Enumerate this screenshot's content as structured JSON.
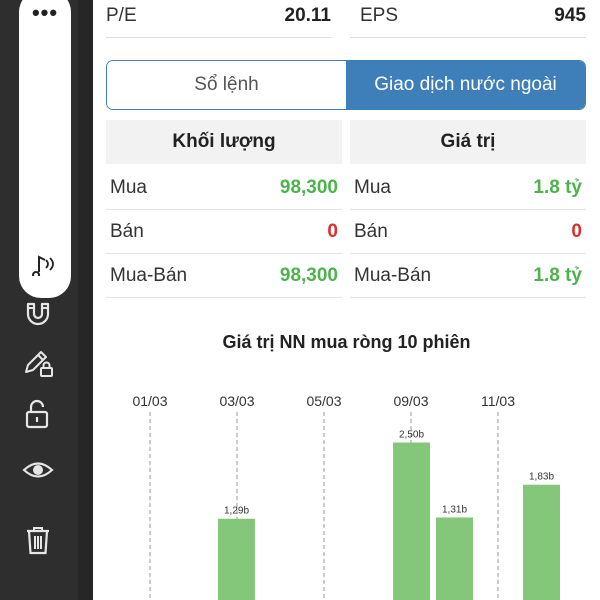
{
  "toolbar": {
    "menu_dots": "•••",
    "icons": [
      "music-notes-icon",
      "magnet-icon",
      "pencil-lock-icon",
      "unlock-icon",
      "eye-icon",
      "trash-icon"
    ]
  },
  "stats": {
    "pe_label": "P/E",
    "pe_value": "20.11",
    "eps_label": "EPS",
    "eps_value": "945"
  },
  "tabs": [
    {
      "label": "Sổ lệnh",
      "active": false
    },
    {
      "label": "Giao dịch nước ngoài",
      "active": true
    }
  ],
  "volume": {
    "header": "Khối lượng",
    "rows": [
      {
        "label": "Mua",
        "value": "98,300",
        "color": "green"
      },
      {
        "label": "Bán",
        "value": "0",
        "color": "red"
      },
      {
        "label": "Mua-Bán",
        "value": "98,300",
        "color": "green"
      }
    ]
  },
  "value": {
    "header": "Giá trị",
    "rows": [
      {
        "label": "Mua",
        "value": "1.8 tỷ",
        "color": "green"
      },
      {
        "label": "Bán",
        "value": "0",
        "color": "red"
      },
      {
        "label": "Mua-Bán",
        "value": "1.8 tỷ",
        "color": "green"
      }
    ]
  },
  "chart_title": "Giá trị NN mua ròng 10 phiên",
  "colors": {
    "accent": "#3f7fb9",
    "positive": "#4db34d",
    "negative": "#d9302c",
    "bar": "#85c77a"
  },
  "chart_data": {
    "type": "bar",
    "title": "Giá trị NN mua ròng 10 phiên",
    "date_labels": [
      "01/03",
      "03/03",
      "05/03",
      "09/03",
      "11/03"
    ],
    "bars": [
      {
        "value": 1.29,
        "label": "1,29b"
      },
      {
        "value": 2.5,
        "label": "2,50b"
      },
      {
        "value": 1.31,
        "label": "1,31b"
      },
      {
        "value": 1.83,
        "label": "1,83b"
      }
    ],
    "unit": "b",
    "grid": true
  }
}
